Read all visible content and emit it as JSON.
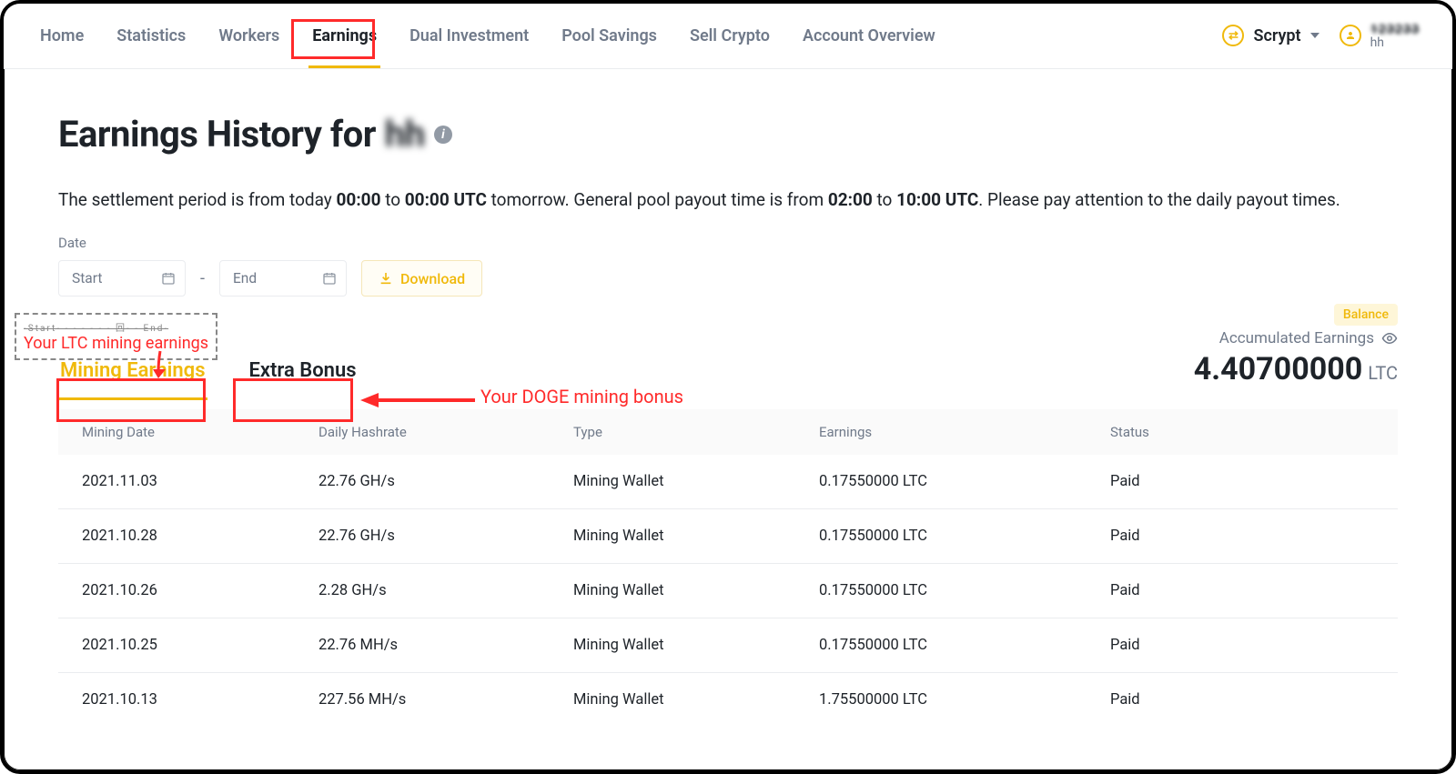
{
  "nav": {
    "items": [
      {
        "label": "Home"
      },
      {
        "label": "Statistics"
      },
      {
        "label": "Workers"
      },
      {
        "label": "Earnings",
        "active": true
      },
      {
        "label": "Dual Investment"
      },
      {
        "label": "Pool Savings"
      },
      {
        "label": "Sell Crypto"
      },
      {
        "label": "Account Overview"
      }
    ],
    "algorithm": "Scrypt",
    "user_primary": "123233",
    "user_secondary": "hh"
  },
  "page": {
    "title_prefix": "Earnings History for ",
    "title_user": "hh",
    "subtitle_parts": {
      "p1": "The settlement period is from today ",
      "b1": "00:00",
      "p2": " to ",
      "b2": "00:00 UTC",
      "p3": " tomorrow. General pool payout time is from ",
      "b3": "02:00",
      "p4": " to ",
      "b4": "10:00 UTC",
      "p5": ". Please pay attention to the daily payout times."
    }
  },
  "controls": {
    "date_label": "Date",
    "start_placeholder": "Start",
    "end_placeholder": "End",
    "download": "Download"
  },
  "balance_badge": "Balance",
  "tabs": {
    "mining": "Mining Earnings",
    "extra": "Extra Bonus"
  },
  "accumulated": {
    "label": "Accumulated Earnings",
    "value": "4.40700000",
    "unit": "LTC"
  },
  "table": {
    "headers": [
      "Mining Date",
      "Daily Hashrate",
      "Type",
      "Earnings",
      "Status"
    ],
    "rows": [
      {
        "date": "2021.11.03",
        "hashrate": "22.76 GH/s",
        "type": "Mining Wallet",
        "earnings": "0.17550000 LTC",
        "status": "Paid"
      },
      {
        "date": "2021.10.28",
        "hashrate": "22.76 GH/s",
        "type": "Mining Wallet",
        "earnings": "0.17550000 LTC",
        "status": "Paid"
      },
      {
        "date": "2021.10.26",
        "hashrate": "2.28 GH/s",
        "type": "Mining Wallet",
        "earnings": "0.17550000 LTC",
        "status": "Paid"
      },
      {
        "date": "2021.10.25",
        "hashrate": "22.76 MH/s",
        "type": "Mining Wallet",
        "earnings": "0.17550000 LTC",
        "status": "Paid"
      },
      {
        "date": "2021.10.13",
        "hashrate": "227.56 MH/s",
        "type": "Mining Wallet",
        "earnings": "1.75500000 LTC",
        "status": "Paid"
      }
    ]
  },
  "annotations": {
    "ltc_label": "Your LTC mining earnings",
    "ltc_mini": "-Start- - - - - - - 回- - End-",
    "doge_label": "Your DOGE mining bonus"
  }
}
